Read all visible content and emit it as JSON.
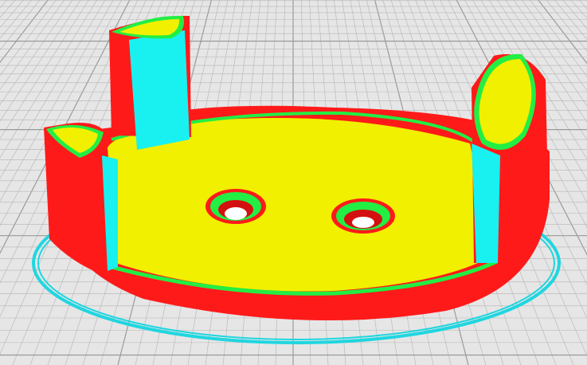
{
  "viewport": {
    "background": "#e6e6e6",
    "grid_line": "#b4b4b4",
    "grid_major": "#9a9a9a"
  },
  "model": {
    "skirt_color": "#1fd6e0",
    "wall_color": "#ff1a1a",
    "wall_dark": "#d40f0f",
    "infill_color": "#f0f000",
    "perimeter_color": "#22ee44",
    "inner_wall_color": "#19f0f0",
    "hole_color": "#ffffff"
  }
}
